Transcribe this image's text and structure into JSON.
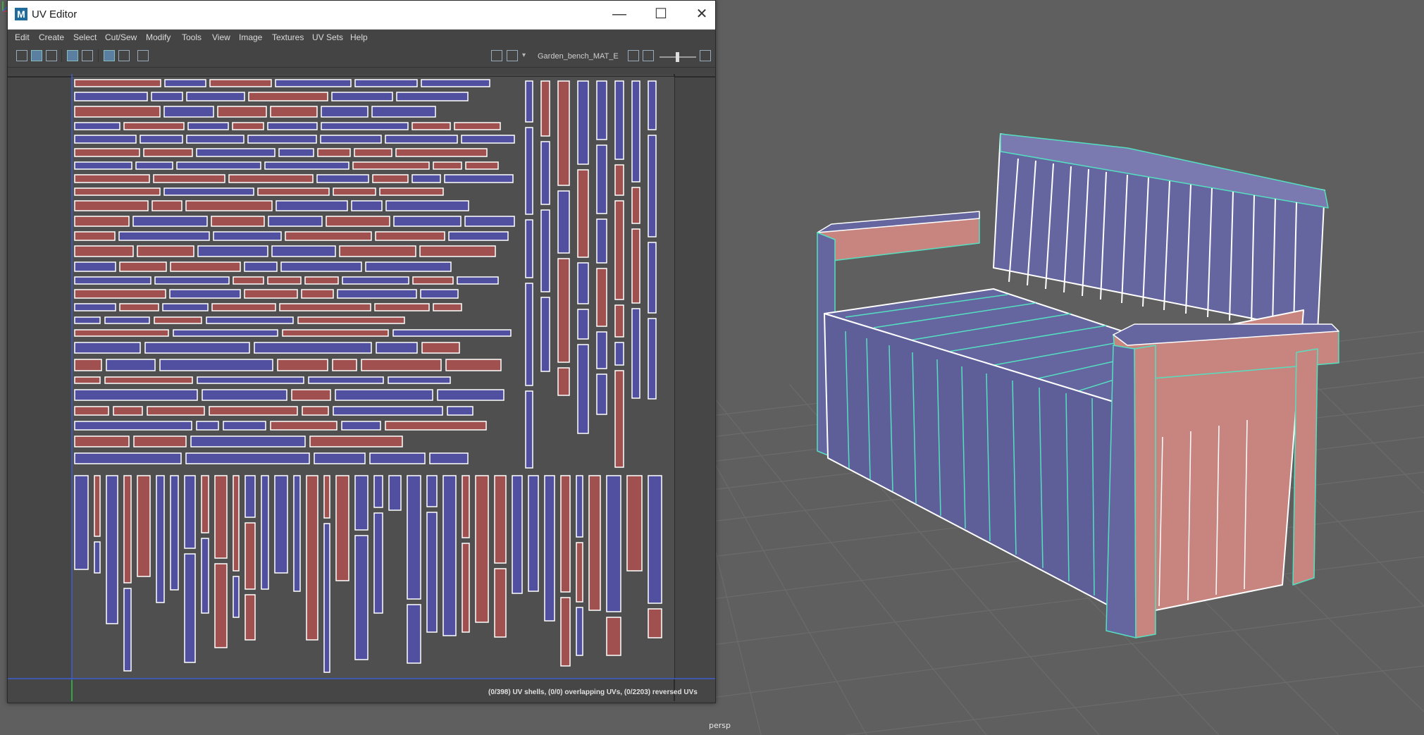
{
  "window": {
    "title": "UV Editor",
    "logo_letter": "M",
    "minimize": "—",
    "maximize": "☐",
    "close": "✕"
  },
  "menu": [
    "Edit",
    "Create",
    "Select",
    "Cut/Sew",
    "Modify",
    "Tools",
    "View",
    "Image",
    "Textures",
    "UV Sets",
    "Help"
  ],
  "toolbar": {
    "texture_name": "Garden_bench_MAT_E"
  },
  "status": {
    "uv_info": "(0/398) UV shells, (0/0) overlapping UVs, (0/2203) reversed UVs"
  },
  "viewport": {
    "camera_label": "persp"
  },
  "colors": {
    "shell_red": "#a0504f",
    "shell_blue": "#5150a0",
    "wire_cyan": "#54e0c0",
    "bench_blue": "#6565a0",
    "bench_pink": "#c8857f"
  }
}
